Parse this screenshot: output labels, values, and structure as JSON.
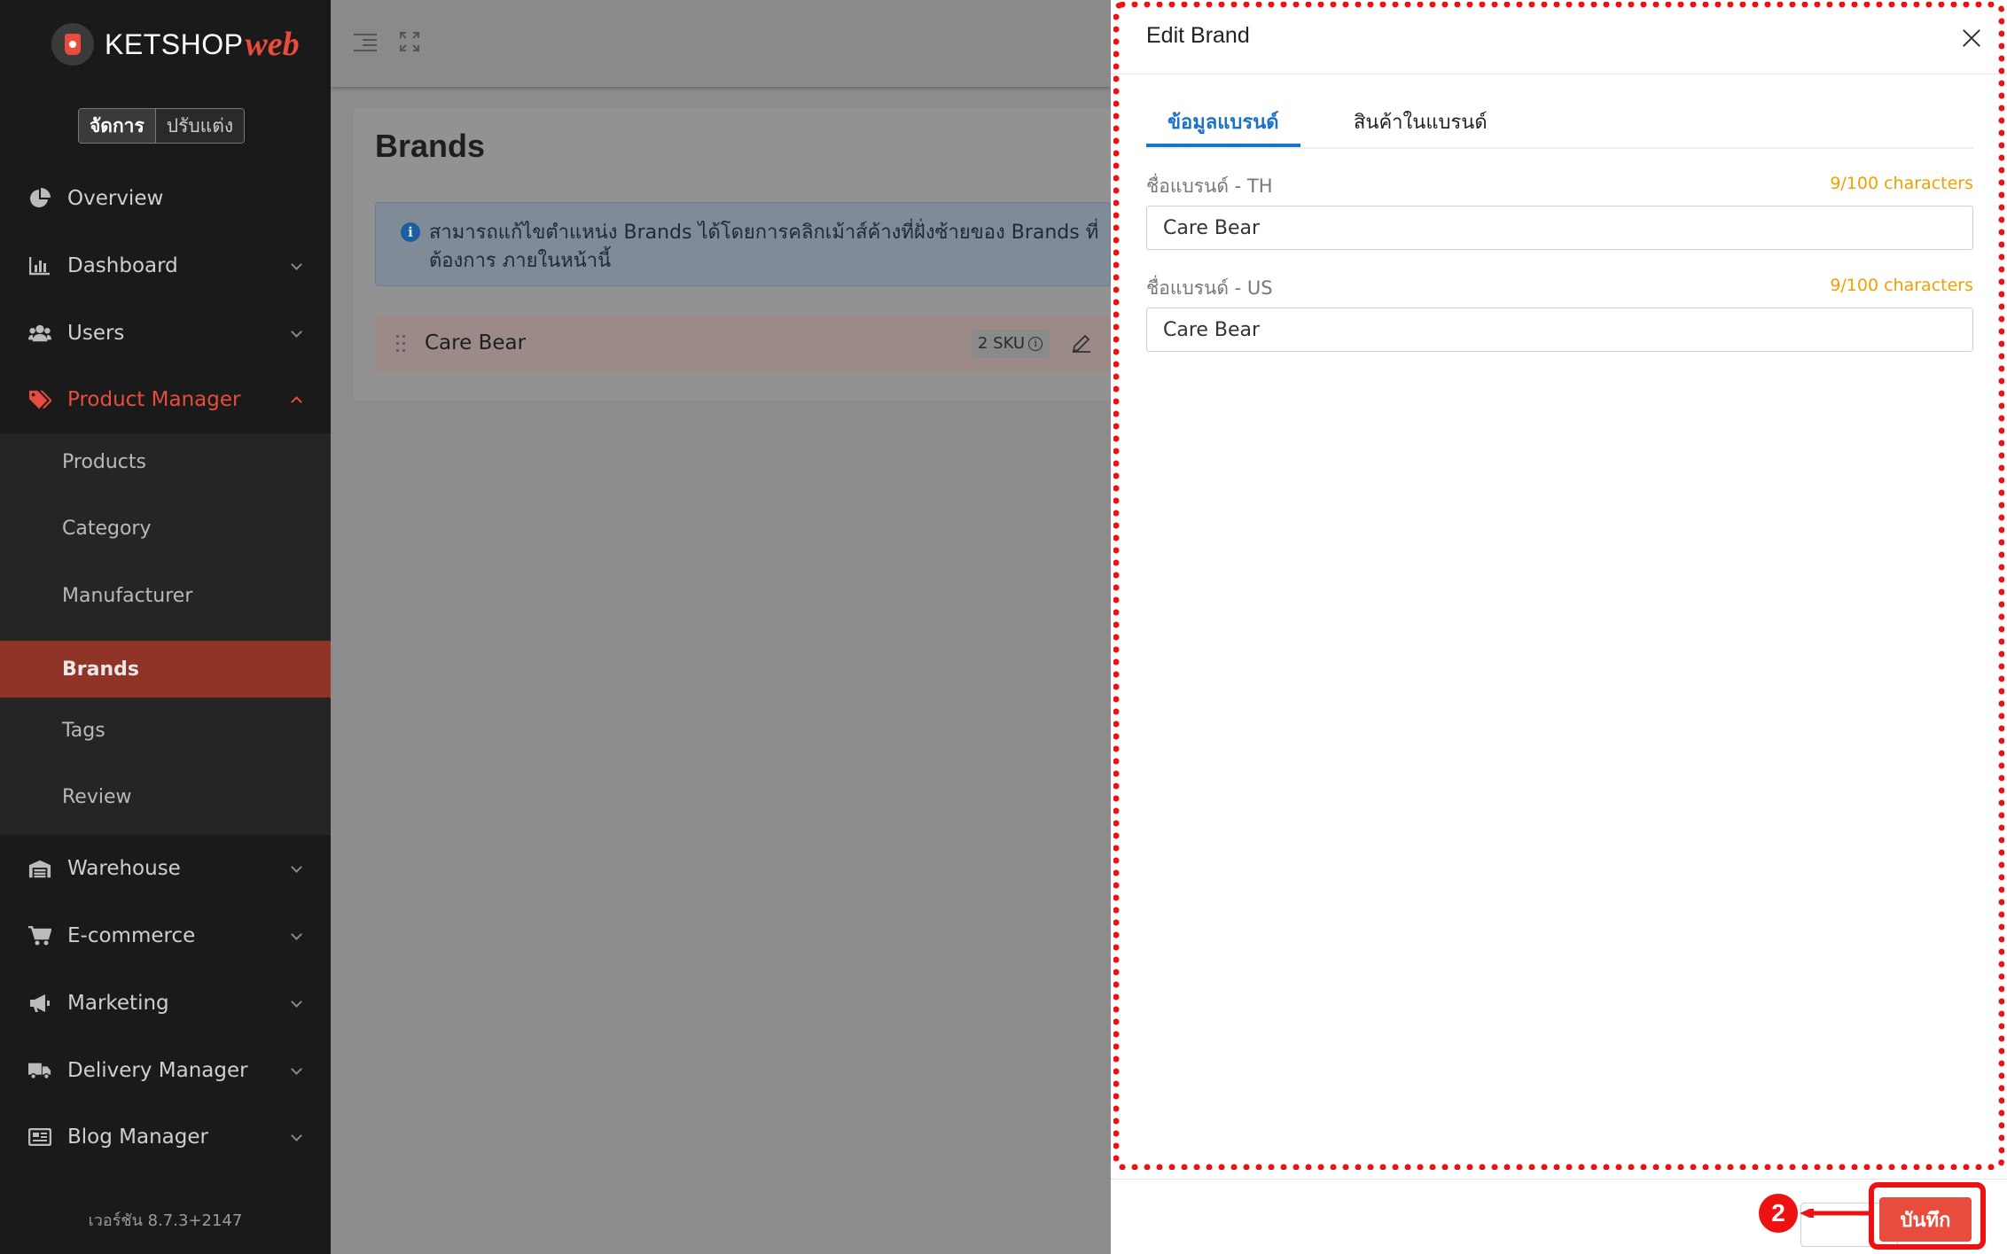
{
  "logo": {
    "text": "KETSHOP",
    "accent": "web"
  },
  "mode_toggle": {
    "active": "จัดการ",
    "inactive": "ปรับแต่ง"
  },
  "nav": {
    "overview": "Overview",
    "dashboard": "Dashboard",
    "users": "Users",
    "product_manager": "Product Manager",
    "warehouse": "Warehouse",
    "ecommerce": "E-commerce",
    "marketing": "Marketing",
    "delivery": "Delivery Manager",
    "blog": "Blog Manager"
  },
  "submenu": {
    "products": "Products",
    "category": "Category",
    "manufacturer": "Manufacturer",
    "brands": "Brands",
    "tags": "Tags",
    "review": "Review"
  },
  "version": "เวอร์ชัน 8.7.3+2147",
  "page": {
    "title": "Brands",
    "info": "สามารถแก้ไขตำแหน่ง Brands ได้โดยการคลิกเม้าส์ค้างที่ฝั่งซ้ายของ Brands ที่ต้องการ ภายในหน้านี้",
    "brand_name": "Care Bear",
    "sku": "2 SKU",
    "sku_icon": "i"
  },
  "drawer": {
    "title": "Edit Brand",
    "tabs": {
      "info": "ข้อมูลแบรนด์",
      "products": "สินค้าในแบรนด์"
    },
    "fields": {
      "th_label": "ชื่อแบรนด์ - TH",
      "th_value": "Care Bear",
      "th_count": "9/100 characters",
      "us_label": "ชื่อแบรนด์ - US",
      "us_value": "Care Bear",
      "us_count": "9/100 characters"
    },
    "save": "บันทึก"
  },
  "annotation": {
    "step": "2"
  },
  "colors": {
    "accent": "#e74c3c",
    "tab": "#1a73c8",
    "count": "#f0a000",
    "annotation": "#ee1111"
  }
}
